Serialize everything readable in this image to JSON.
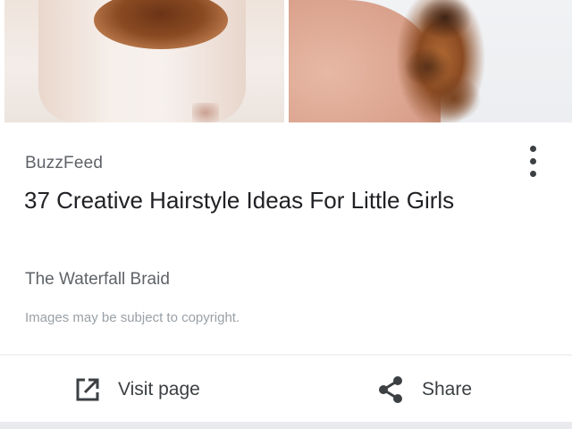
{
  "card": {
    "source": "BuzzFeed",
    "title": "37 Creative Hairstyle Ideas For Little Girls",
    "subtitle": "The Waterfall Braid",
    "copyright": "Images may be subject to copyright."
  },
  "actions": {
    "visit_label": "Visit page",
    "share_label": "Share"
  },
  "icons": {
    "menu": "more-vert-icon",
    "visit": "open-in-new-icon",
    "share": "share-icon"
  },
  "colors": {
    "text_primary": "#202124",
    "text_secondary": "#5f6368",
    "text_muted": "#9aa0a6"
  }
}
